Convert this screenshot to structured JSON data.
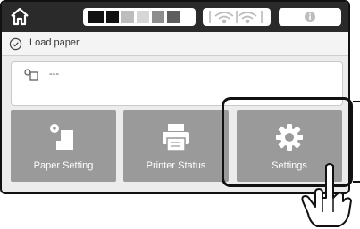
{
  "status": {
    "message": "Load paper."
  },
  "paper_info": {
    "value": "---"
  },
  "tiles": [
    {
      "label": "Paper Setting",
      "icon": "paper-setting-icon"
    },
    {
      "label": "Printer Status",
      "icon": "printer-icon"
    },
    {
      "label": "Settings",
      "icon": "gear-icon"
    }
  ],
  "ink_levels": [
    {
      "color": "#111111",
      "level": 1.0
    },
    {
      "color": "#111111",
      "level": 1.0
    },
    {
      "color": "#bdbdbd",
      "level": 1.0
    },
    {
      "color": "#d6d6d6",
      "level": 1.0
    },
    {
      "color": "#8e8e8e",
      "level": 1.0
    },
    {
      "color": "#5e5e5e",
      "level": 1.0
    }
  ],
  "colors": {
    "topbar": "#2a2a2a",
    "tile": "#9a9a9a",
    "screen_bg": "#ececec"
  },
  "icons": {
    "home": "home-icon",
    "wifi": "wifi-icon",
    "info": "info-icon",
    "check": "check-circle-icon",
    "pointer": "hand-pointer-icon"
  }
}
